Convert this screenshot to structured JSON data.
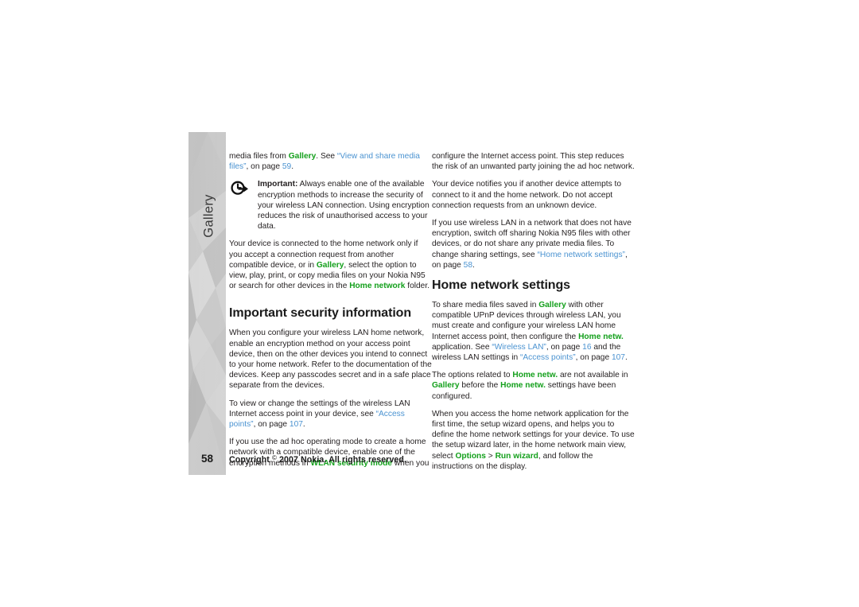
{
  "page": {
    "chapter_tab_label": "Gallery",
    "page_number": "58",
    "copyright_pre": "Copyright",
    "copyright_symbol": "©",
    "copyright_post": "2007 Nokia. All rights reserved."
  },
  "icons": {
    "important_note": "important-note-icon"
  },
  "colors": {
    "green_term": "#14A01C",
    "blue_link": "#4B93D1",
    "body_text": "#231f20",
    "tab_gray_light": "#d5d5d5",
    "tab_gray_dark": "#b9b9b9"
  },
  "left_column": {
    "para_1": {
      "t1": "media files from ",
      "term1": "Gallery",
      "t2": ". See ",
      "link1": "“View and share media files”",
      "t3": ", on page ",
      "link2": "59",
      "t4": "."
    },
    "note": {
      "label": "Important:",
      "body": " Always enable one of the available encryption methods to increase the security of your wireless LAN connection. Using encryption reduces the risk of unauthorised access to your data."
    },
    "para_2": {
      "t1": "Your device is connected to the home network only if you accept a connection request from another compatible device, or in ",
      "term1": "Gallery",
      "t2": ", select the option to view, play, print, or copy media files on your Nokia N95 or search for other devices in the ",
      "term2": "Home network",
      "t3": " folder."
    },
    "heading": "Important security information",
    "para_3": "When you configure your wireless LAN home network, enable an encryption method on your access point device, then on the other devices you intend to connect to your home network. Refer to the documentation of the devices. Keep any passcodes secret and in a safe place separate from the devices.",
    "para_4": {
      "t1": "To view or change the settings of the wireless LAN Internet access point in your device, see ",
      "link1": "“Access points”",
      "t2": ", on page ",
      "link2": "107",
      "t3": "."
    },
    "para_5": {
      "t1": "If you use the ad hoc operating mode to create a home network with a compatible device, enable one of the encryption methods in ",
      "term1": "WLAN security mode",
      "t2": " when you"
    }
  },
  "right_column": {
    "para_1": "configure the Internet access point. This step reduces the risk of an unwanted party joining the ad hoc network.",
    "para_2": "Your device notifies you if another device attempts to connect to it and the home network. Do not accept connection requests from an unknown device.",
    "para_3": {
      "t1": "If you use wireless LAN in a network that does not have encryption, switch off sharing Nokia N95 files with other devices, or do not share any private media files. To change sharing settings, see ",
      "link1": "“Home network settings”",
      "t2": ", on page ",
      "link2": "58",
      "t3": "."
    },
    "heading": "Home network settings",
    "para_4": {
      "t1": "To share media files saved in ",
      "term1": "Gallery",
      "t2": " with other compatible UPnP devices through wireless LAN, you must create and configure your wireless LAN home Internet access point, then configure the ",
      "term2": "Home netw.",
      "t3": " application. See ",
      "link1": "“Wireless LAN”",
      "t4": ", on page ",
      "link2": "16",
      "t5": " and the wireless LAN settings in ",
      "link3": "“Access points”",
      "t6": ", on page ",
      "link4": "107",
      "t7": "."
    },
    "para_5": {
      "t1": "The options related to ",
      "term1": "Home netw.",
      "t2": " are not available in ",
      "term2": "Gallery",
      "t3": " before the ",
      "term3": "Home netw.",
      "t4": " settings have been configured."
    },
    "para_6": {
      "t1": "When you access the home network application for the first time, the setup wizard opens, and helps you to define the home network settings for your device. To use the setup wizard later, in the home network main view, select ",
      "term1": "Options",
      "t2": " > ",
      "term2": "Run wizard",
      "t3": ", and follow the instructions on the display."
    }
  }
}
